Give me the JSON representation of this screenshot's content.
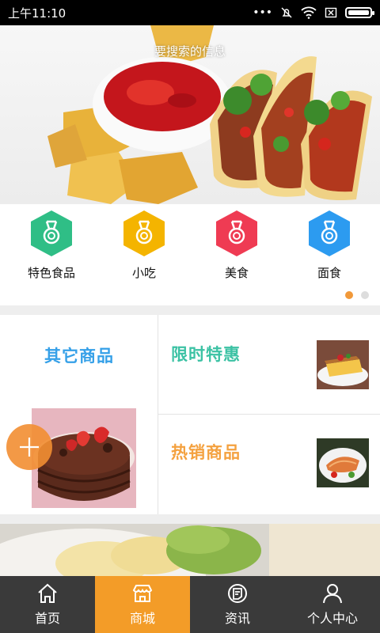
{
  "status_bar": {
    "time": "上午11:10",
    "icons": [
      "more-dots-icon",
      "mute-icon",
      "wifi-icon",
      "sim-off-icon",
      "battery-icon"
    ]
  },
  "banner": {
    "search_hint": "要搜索的信息"
  },
  "categories": [
    {
      "label": "特色食品",
      "icon": "medal-icon",
      "color": "#2fbe86"
    },
    {
      "label": "小吃",
      "icon": "medal-icon",
      "color": "#f4b400"
    },
    {
      "label": "美食",
      "icon": "medal-icon",
      "color": "#ef3b53"
    },
    {
      "label": "面食",
      "icon": "medal-icon",
      "color": "#2c9bf0"
    }
  ],
  "pager": {
    "count": 2,
    "active": 0,
    "active_color": "#f1993a"
  },
  "features": {
    "other": {
      "title": "其它商品",
      "color": "#35a0e8"
    },
    "limited": {
      "title": "限时特惠",
      "color": "#3cc2a4"
    },
    "hot": {
      "title": "热销商品",
      "color": "#f4a13f"
    }
  },
  "fab": {
    "icon": "plus-icon"
  },
  "tabbar": {
    "active_color": "#f39c28",
    "items": [
      {
        "label": "首页",
        "icon": "home-icon"
      },
      {
        "label": "商城",
        "icon": "shop-icon"
      },
      {
        "label": "资讯",
        "icon": "news-icon"
      },
      {
        "label": "个人中心",
        "icon": "user-icon"
      }
    ]
  }
}
